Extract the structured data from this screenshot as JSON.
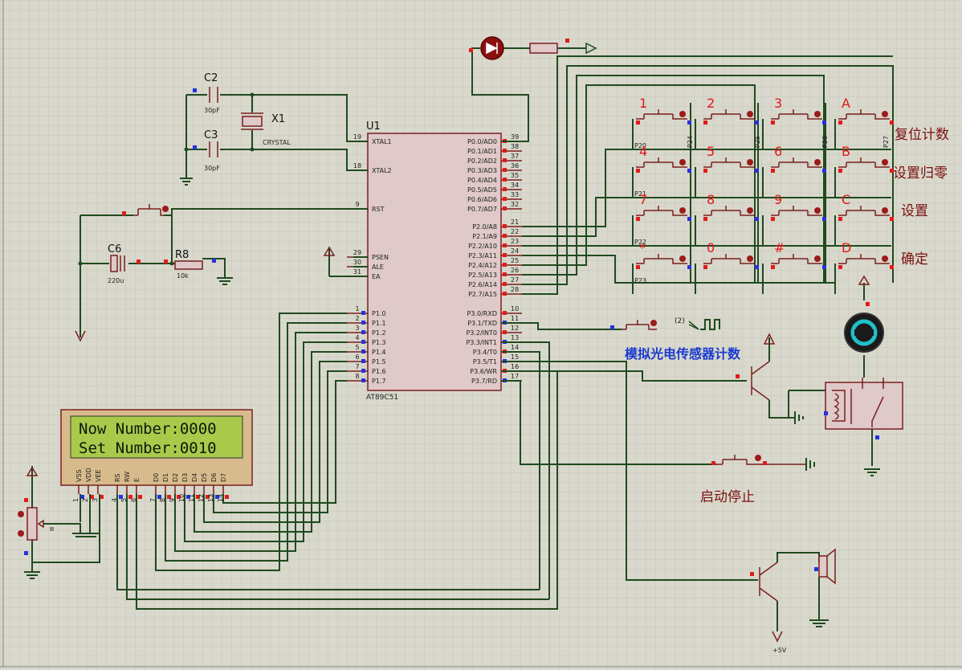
{
  "window": {
    "title": ""
  },
  "mcu": {
    "ref": "U1",
    "part": "AT89C51",
    "left_pins": [
      {
        "num": "19",
        "name": "XTAL1"
      },
      {
        "num": "18",
        "name": "XTAL2"
      },
      {
        "num": "9",
        "name": "RST"
      },
      {
        "num": "29",
        "name": "PSEN"
      },
      {
        "num": "30",
        "name": "ALE"
      },
      {
        "num": "31",
        "name": "EA"
      },
      {
        "num": "1",
        "name": "P1.0"
      },
      {
        "num": "2",
        "name": "P1.1"
      },
      {
        "num": "3",
        "name": "P1.2"
      },
      {
        "num": "4",
        "name": "P1.3"
      },
      {
        "num": "5",
        "name": "P1.4"
      },
      {
        "num": "6",
        "name": "P1.5"
      },
      {
        "num": "7",
        "name": "P1.6"
      },
      {
        "num": "8",
        "name": "P1.7"
      }
    ],
    "right_pins": [
      {
        "num": "39",
        "name": "P0.0/AD0"
      },
      {
        "num": "38",
        "name": "P0.1/AD1"
      },
      {
        "num": "37",
        "name": "P0.2/AD2"
      },
      {
        "num": "36",
        "name": "P0.3/AD3"
      },
      {
        "num": "35",
        "name": "P0.4/AD4"
      },
      {
        "num": "34",
        "name": "P0.5/AD5"
      },
      {
        "num": "33",
        "name": "P0.6/AD6"
      },
      {
        "num": "32",
        "name": "P0.7/AD7"
      },
      {
        "num": "21",
        "name": "P2.0/A8"
      },
      {
        "num": "22",
        "name": "P2.1/A9"
      },
      {
        "num": "23",
        "name": "P2.2/A10"
      },
      {
        "num": "24",
        "name": "P2.3/A11"
      },
      {
        "num": "25",
        "name": "P2.4/A12"
      },
      {
        "num": "26",
        "name": "P2.5/A13"
      },
      {
        "num": "27",
        "name": "P2.6/A14"
      },
      {
        "num": "28",
        "name": "P2.7/A15"
      },
      {
        "num": "10",
        "name": "P3.0/RXD"
      },
      {
        "num": "11",
        "name": "P3.1/TXD"
      },
      {
        "num": "12",
        "name": "P3.2/INT0"
      },
      {
        "num": "13",
        "name": "P3.3/INT1"
      },
      {
        "num": "14",
        "name": "P3.4/T0"
      },
      {
        "num": "15",
        "name": "P3.5/T1"
      },
      {
        "num": "16",
        "name": "P3.6/WR"
      },
      {
        "num": "17",
        "name": "P3.7/RD"
      }
    ]
  },
  "components": {
    "c2": {
      "ref": "C2",
      "value": "30pF"
    },
    "c3": {
      "ref": "C3",
      "value": "30pF"
    },
    "x1": {
      "ref": "X1",
      "value": "CRYSTAL"
    },
    "c6": {
      "ref": "C6",
      "value": "220u"
    },
    "r8": {
      "ref": "R8",
      "value": "10k"
    },
    "vcc": "+5V",
    "signal": "(2)"
  },
  "lcd": {
    "line1": "Now Number:0000",
    "line2": "Set Number:0010",
    "pins": [
      {
        "name": "VSS",
        "num": "1"
      },
      {
        "name": "VDD",
        "num": "2"
      },
      {
        "name": "VEE",
        "num": "3"
      },
      {
        "name": "RS",
        "num": "4"
      },
      {
        "name": "RW",
        "num": "5"
      },
      {
        "name": "E",
        "num": "6"
      },
      {
        "name": "D0",
        "num": "7"
      },
      {
        "name": "D1",
        "num": "8"
      },
      {
        "name": "D2",
        "num": "9"
      },
      {
        "name": "D3",
        "num": "10"
      },
      {
        "name": "D4",
        "num": "11"
      },
      {
        "name": "D5",
        "num": "12"
      },
      {
        "name": "D6",
        "num": "13"
      },
      {
        "name": "D7",
        "num": "14"
      }
    ]
  },
  "keypad": {
    "keys": [
      "1",
      "2",
      "3",
      "A",
      "4",
      "5",
      "6",
      "B",
      "7",
      "8",
      "9",
      "C",
      "*",
      "0",
      "#",
      "D"
    ],
    "row_nets": [
      "P20",
      "P21",
      "P22",
      "P23"
    ],
    "col_nets": [
      "P24",
      "P25",
      "P26",
      "P27"
    ],
    "functions": [
      "复位计数",
      "设置归零",
      "设置",
      "确定"
    ]
  },
  "labels": {
    "sensor": "模拟光电传感器计数",
    "start_stop": "启动停止"
  },
  "colors": {
    "background": "#d9d8cc",
    "wire": "#1f4a1f",
    "component": "#7a1f1f",
    "key_label": "#e01818",
    "lcd_screen": "#a9c94a"
  }
}
